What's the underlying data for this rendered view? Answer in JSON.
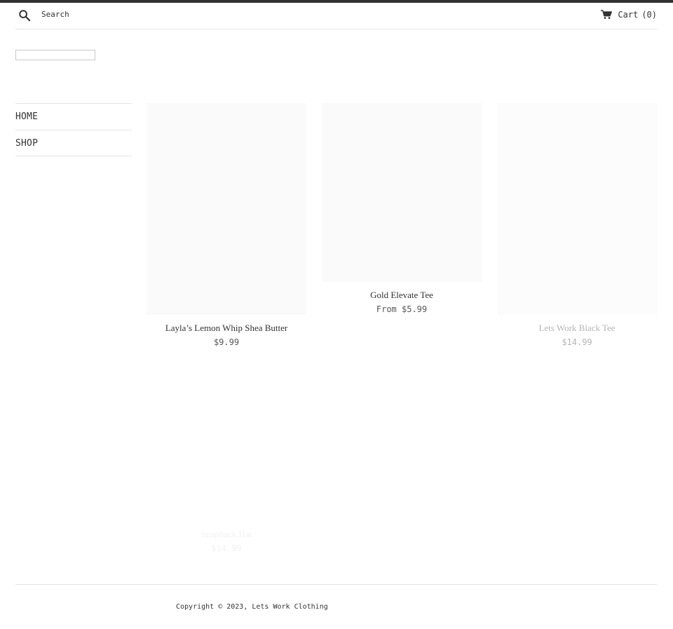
{
  "header": {
    "search_label": "Search",
    "cart_label": "Cart",
    "cart_count": "(0)"
  },
  "sidebar": {
    "items": [
      {
        "label": "HOME"
      },
      {
        "label": "SHOP"
      }
    ]
  },
  "products": [
    {
      "title": "Layla’s Lemon Whip Shea Butter",
      "price": "$9.99"
    },
    {
      "title": "Gold Elevate Tee",
      "price": "From $5.99"
    },
    {
      "title": "Lets Work Black Tee",
      "price": "$14.99"
    },
    {
      "title": "Snapback Hat",
      "price": "$14.99"
    }
  ],
  "footer": {
    "copyright": "Copyright © 2023, Lets Work Clothing"
  }
}
